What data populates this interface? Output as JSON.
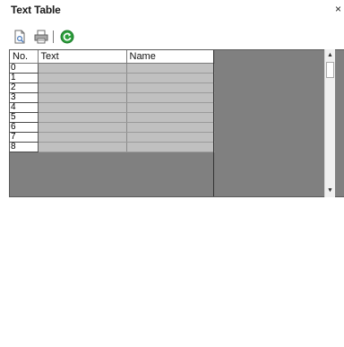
{
  "panel": {
    "title": "Text Table",
    "close_label": "×"
  },
  "toolbar": {
    "buttons": [
      {
        "icon": "new-document-icon"
      },
      {
        "icon": "print-icon"
      },
      {
        "icon": "refresh-icon"
      }
    ]
  },
  "table": {
    "columns": [
      "No.",
      "Text",
      "Name"
    ],
    "rows": [
      {
        "no": "0",
        "text": "",
        "name": ""
      },
      {
        "no": "1",
        "text": "",
        "name": ""
      },
      {
        "no": "2",
        "text": "",
        "name": ""
      },
      {
        "no": "3",
        "text": "",
        "name": ""
      },
      {
        "no": "4",
        "text": "",
        "name": ""
      },
      {
        "no": "5",
        "text": "",
        "name": ""
      },
      {
        "no": "6",
        "text": "",
        "name": ""
      },
      {
        "no": "7",
        "text": "",
        "name": ""
      },
      {
        "no": "8",
        "text": "",
        "name": ""
      }
    ]
  },
  "colors": {
    "cell_bg": "#c0c0c0",
    "empty_area": "#808080",
    "refresh_green": "#2a9d3a"
  }
}
